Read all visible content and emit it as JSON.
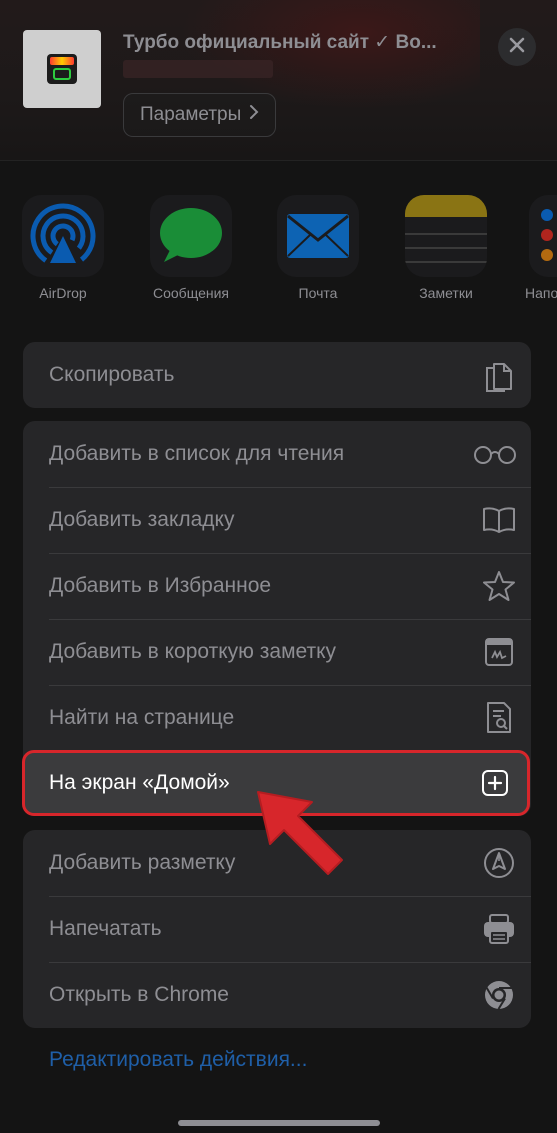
{
  "header": {
    "site_title": "Турбо официальный сайт ✓ Во...",
    "params_label": "Параметры",
    "close_icon": "close-icon"
  },
  "apps": [
    {
      "label": "AirDrop",
      "icon": "airdrop-icon"
    },
    {
      "label": "Сообщения",
      "icon": "messages-icon"
    },
    {
      "label": "Почта",
      "icon": "mail-icon"
    },
    {
      "label": "Заметки",
      "icon": "notes-icon"
    },
    {
      "label": "Напо",
      "icon": "reminders-icon"
    }
  ],
  "actions": {
    "copy": {
      "label": "Скопировать",
      "icon": "copy-icon"
    },
    "reading_list": {
      "label": "Добавить в список для чтения",
      "icon": "glasses-icon"
    },
    "bookmark": {
      "label": "Добавить закладку",
      "icon": "book-icon"
    },
    "favorites": {
      "label": "Добавить в Избранное",
      "icon": "star-icon"
    },
    "quick_note": {
      "label": "Добавить в короткую заметку",
      "icon": "quick-note-icon"
    },
    "find_on_page": {
      "label": "Найти на странице",
      "icon": "find-page-icon"
    },
    "home_screen": {
      "label": "На экран «Домой»",
      "icon": "add-square-icon"
    },
    "markup": {
      "label": "Добавить разметку",
      "icon": "markup-pen-icon"
    },
    "print": {
      "label": "Напечатать",
      "icon": "printer-icon"
    },
    "chrome": {
      "label": "Открыть в Chrome",
      "icon": "chrome-icon"
    }
  },
  "edit_actions_label": "Редактировать действия...",
  "colors": {
    "highlight_border": "#d7262b",
    "arrow": "#d7262b",
    "link_blue": "#1f5fa8"
  }
}
